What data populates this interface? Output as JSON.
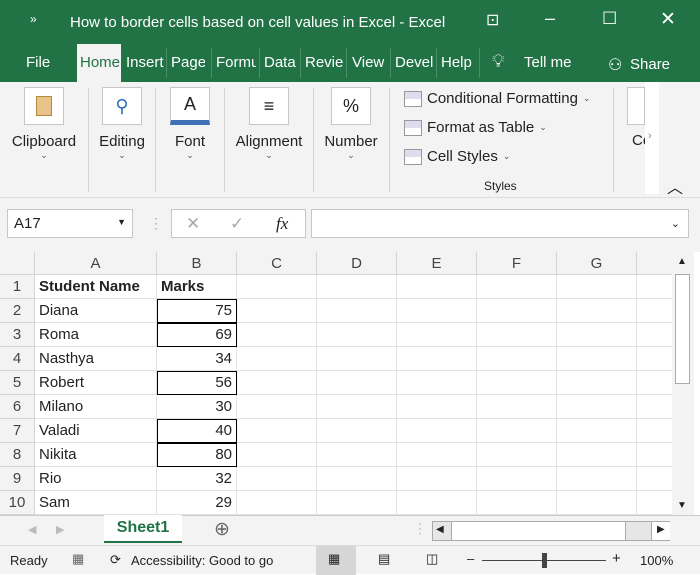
{
  "window": {
    "title": "How to border cells based on cell values in Excel  -  Excel"
  },
  "tabs": [
    {
      "label": "File"
    },
    {
      "label": "Home"
    },
    {
      "label": "Insert"
    },
    {
      "label": "Page"
    },
    {
      "label": "Formu"
    },
    {
      "label": "Data"
    },
    {
      "label": "Revie"
    },
    {
      "label": "View"
    },
    {
      "label": "Devel"
    },
    {
      "label": "Help"
    }
  ],
  "tell_me": "Tell me",
  "share": "Share",
  "ribbon": {
    "groups": [
      {
        "label": "Clipboard",
        "icon": "clipboard-icon"
      },
      {
        "label": "Editing",
        "icon": "search-icon",
        "glyph": "⚲"
      },
      {
        "label": "Font",
        "icon": "font-color-icon",
        "glyph": "A"
      },
      {
        "label": "Alignment",
        "icon": "align-icon",
        "glyph": "≡"
      },
      {
        "label": "Number",
        "icon": "percent-icon",
        "glyph": "%"
      }
    ],
    "styles": {
      "items": [
        "Conditional Formatting",
        "Format as Table",
        "Cell Styles"
      ],
      "label": "Styles"
    },
    "cells_partial": "Ce"
  },
  "formula_bar": {
    "name_box": "A17",
    "fx": "fx",
    "value": ""
  },
  "columns": [
    "A",
    "B",
    "C",
    "D",
    "E",
    "F",
    "G"
  ],
  "rows": [
    {
      "n": "1",
      "a": "Student Name",
      "b": "Marks",
      "bordered": false
    },
    {
      "n": "2",
      "a": "Diana",
      "b": "75",
      "bordered": true
    },
    {
      "n": "3",
      "a": "Roma",
      "b": "69",
      "bordered": true
    },
    {
      "n": "4",
      "a": "Nasthya",
      "b": "34",
      "bordered": false
    },
    {
      "n": "5",
      "a": "Robert",
      "b": "56",
      "bordered": true
    },
    {
      "n": "6",
      "a": "Milano",
      "b": "30",
      "bordered": false
    },
    {
      "n": "7",
      "a": "Valadi",
      "b": "40",
      "bordered": true
    },
    {
      "n": "8",
      "a": "Nikita",
      "b": "80",
      "bordered": true
    },
    {
      "n": "9",
      "a": "Rio",
      "b": "32",
      "bordered": false
    },
    {
      "n": "10",
      "a": "Sam",
      "b": "29",
      "bordered": false
    }
  ],
  "sheet": {
    "tab": "Sheet1"
  },
  "status": {
    "ready": "Ready",
    "accessibility": "Accessibility: Good to go",
    "zoom": "100%",
    "zoom_level": 0.5
  },
  "colors": {
    "accent": "#217346",
    "ribbon": "#f3f3f3"
  }
}
